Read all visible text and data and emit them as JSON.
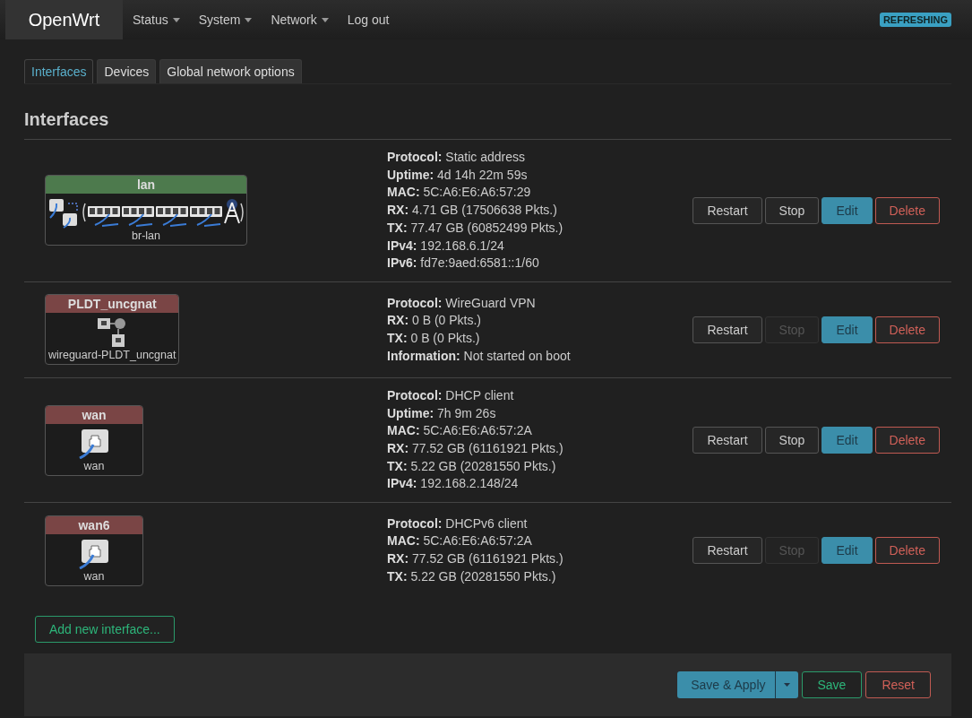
{
  "brand": "OpenWrt",
  "menu": [
    {
      "label": "Status",
      "dropdown": true
    },
    {
      "label": "System",
      "dropdown": true
    },
    {
      "label": "Network",
      "dropdown": true
    },
    {
      "label": "Log out",
      "dropdown": false
    }
  ],
  "status_badge": "REFRESHING",
  "tabs": [
    {
      "label": "Interfaces",
      "selected": true
    },
    {
      "label": "Devices",
      "selected": false
    },
    {
      "label": "Global network options",
      "selected": false
    }
  ],
  "heading": "Interfaces",
  "interfaces": [
    {
      "name": "lan",
      "color": "#4d7a4d",
      "kind": "bridge",
      "device": "br-lan",
      "details": [
        {
          "label": "Protocol:",
          "value": "Static address"
        },
        {
          "label": "Uptime:",
          "value": "4d 14h 22m 59s"
        },
        {
          "label": "MAC:",
          "value": "5C:A6:E6:A6:57:29"
        },
        {
          "label": "RX:",
          "value": "4.71 GB (17506638 Pkts.)"
        },
        {
          "label": "TX:",
          "value": "77.47 GB (60852499 Pkts.)"
        },
        {
          "label": "IPv4:",
          "value": "192.168.6.1/24"
        },
        {
          "label": "IPv6:",
          "value": "fd7e:9aed:6581::1/60"
        }
      ],
      "buttons": [
        {
          "label": "Restart",
          "kind": "plain",
          "disabled": false
        },
        {
          "label": "Stop",
          "kind": "plain",
          "disabled": false
        },
        {
          "label": "Edit",
          "kind": "primary",
          "disabled": false
        },
        {
          "label": "Delete",
          "kind": "danger",
          "disabled": false
        }
      ]
    },
    {
      "name": "PLDT_uncgnat",
      "color": "#7a4545",
      "kind": "tunnel",
      "device": "wireguard-PLDT_uncgnat",
      "details": [
        {
          "label": "Protocol:",
          "value": "WireGuard VPN"
        },
        {
          "label": "RX:",
          "value": "0 B (0 Pkts.)"
        },
        {
          "label": "TX:",
          "value": "0 B (0 Pkts.)"
        },
        {
          "label": "Information:",
          "value": "Not started on boot"
        }
      ],
      "buttons": [
        {
          "label": "Restart",
          "kind": "plain",
          "disabled": false
        },
        {
          "label": "Stop",
          "kind": "plain",
          "disabled": true
        },
        {
          "label": "Edit",
          "kind": "primary",
          "disabled": false
        },
        {
          "label": "Delete",
          "kind": "danger",
          "disabled": false
        }
      ]
    },
    {
      "name": "wan",
      "color": "#7a4545",
      "kind": "ethernet",
      "device": "wan",
      "details": [
        {
          "label": "Protocol:",
          "value": "DHCP client"
        },
        {
          "label": "Uptime:",
          "value": "7h 9m 26s"
        },
        {
          "label": "MAC:",
          "value": "5C:A6:E6:A6:57:2A"
        },
        {
          "label": "RX:",
          "value": "77.52 GB (61161921 Pkts.)"
        },
        {
          "label": "TX:",
          "value": "5.22 GB (20281550 Pkts.)"
        },
        {
          "label": "IPv4:",
          "value": "192.168.2.148/24"
        }
      ],
      "buttons": [
        {
          "label": "Restart",
          "kind": "plain",
          "disabled": false
        },
        {
          "label": "Stop",
          "kind": "plain",
          "disabled": false
        },
        {
          "label": "Edit",
          "kind": "primary",
          "disabled": false
        },
        {
          "label": "Delete",
          "kind": "danger",
          "disabled": false
        }
      ]
    },
    {
      "name": "wan6",
      "color": "#7a4545",
      "kind": "ethernet",
      "device": "wan",
      "details": [
        {
          "label": "Protocol:",
          "value": "DHCPv6 client"
        },
        {
          "label": "MAC:",
          "value": "5C:A6:E6:A6:57:2A"
        },
        {
          "label": "RX:",
          "value": "77.52 GB (61161921 Pkts.)"
        },
        {
          "label": "TX:",
          "value": "5.22 GB (20281550 Pkts.)"
        }
      ],
      "buttons": [
        {
          "label": "Restart",
          "kind": "plain",
          "disabled": false
        },
        {
          "label": "Stop",
          "kind": "plain",
          "disabled": true
        },
        {
          "label": "Edit",
          "kind": "primary",
          "disabled": false
        },
        {
          "label": "Delete",
          "kind": "danger",
          "disabled": false
        }
      ]
    }
  ],
  "add_button": "Add new interface...",
  "footer_buttons": [
    {
      "label": "Save & Apply",
      "kind": "primary",
      "split": true
    },
    {
      "label": "Save",
      "kind": "success",
      "split": false
    },
    {
      "label": "Reset",
      "kind": "danger",
      "split": false
    }
  ]
}
